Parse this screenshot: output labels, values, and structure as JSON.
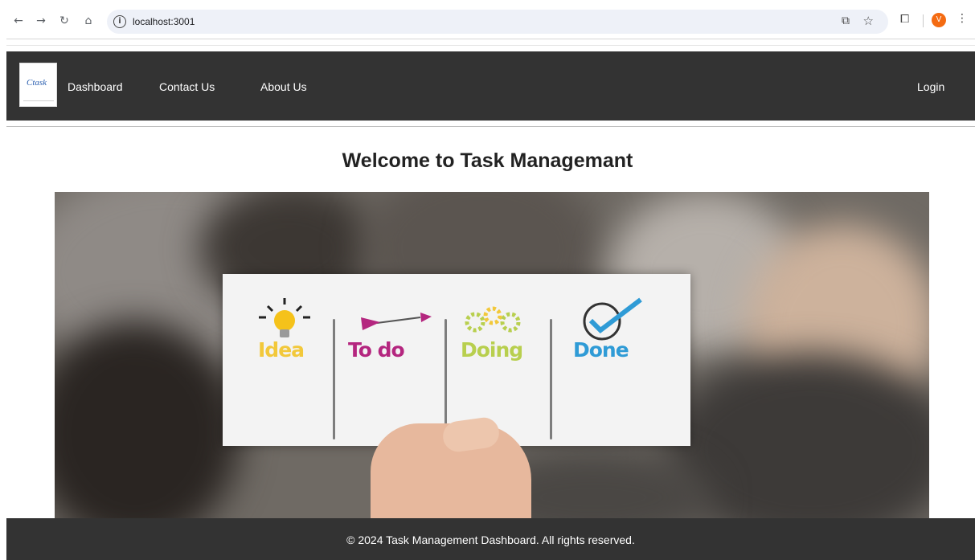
{
  "browser": {
    "url": "localhost:3001",
    "profile_initial": "V",
    "icons": {
      "back": "arrow-left-icon",
      "forward": "arrow-right-icon",
      "reload": "reload-icon",
      "home": "home-icon",
      "info": "info-icon",
      "cast": "cast-icon",
      "bookmark": "star-icon",
      "extensions": "puzzle-icon",
      "menu": "more-vertical-icon"
    }
  },
  "header": {
    "logo_text": "Ctask",
    "nav": [
      {
        "label": "Dashboard"
      },
      {
        "label": "Contact Us"
      },
      {
        "label": "About Us"
      }
    ],
    "login_label": "Login"
  },
  "main": {
    "title": "Welcome to Task Managemant",
    "hero": {
      "stages": [
        {
          "label": "Idea",
          "color": "#f2c83a"
        },
        {
          "label": "To do",
          "color": "#b4267f"
        },
        {
          "label": "Doing",
          "color": "#b8cf4e"
        },
        {
          "label": "Done",
          "color": "#2f9bd6"
        }
      ]
    }
  },
  "footer": {
    "text": "© 2024 Task Management Dashboard. All rights reserved."
  },
  "colors": {
    "header_bg": "#333333",
    "footer_bg": "#333333",
    "profile_avatar": "#f46b12"
  }
}
